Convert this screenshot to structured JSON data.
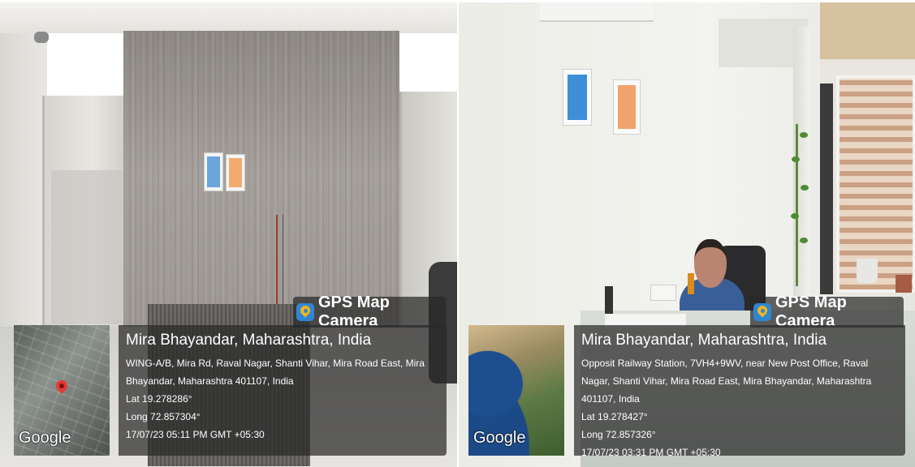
{
  "panels": [
    {
      "badge": "GPS Map Camera",
      "map_label": "Google",
      "city": "Mira Bhayandar, Maharashtra, India",
      "address": "WING-A/B, Mira Rd, Raval Nagar, Shanti Vihar, Mira Road East, Mira Bhayandar, Maharashtra 401107, India",
      "lat": "Lat 19.278286°",
      "long": "Long 72.857304°",
      "datetime": "17/07/23 05:11 PM GMT +05:30"
    },
    {
      "badge": "GPS Map Camera",
      "map_label": "Google",
      "city": "Mira Bhayandar, Maharashtra, India",
      "address": "Opposit Railway Station, 7VH4+9WV, near New Post Office, Raval Nagar, Shanti Vihar, Mira Road East, Mira Bhayandar, Maharashtra 401107, India",
      "lat": "Lat 19.278427°",
      "long": "Long 72.857326°",
      "datetime": "17/07/23 03:31 PM GMT +05:30"
    }
  ]
}
